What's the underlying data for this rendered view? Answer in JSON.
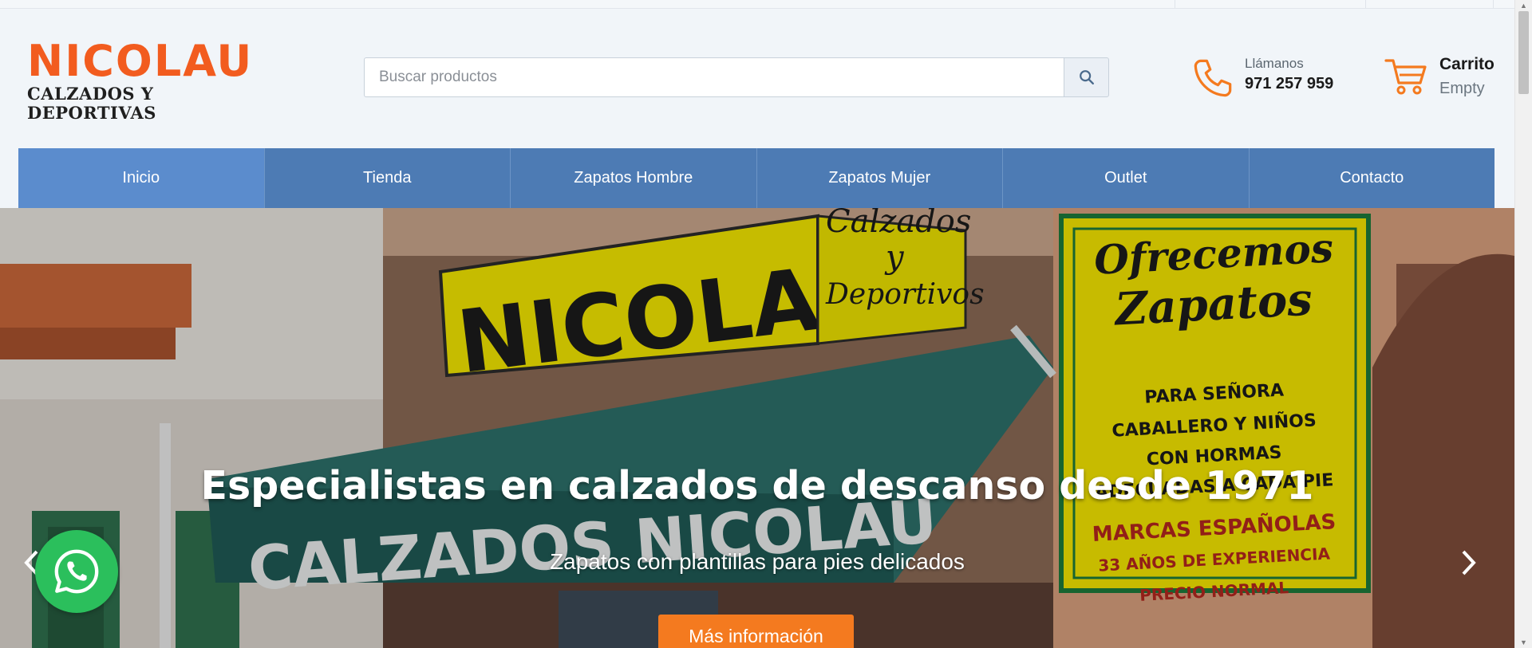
{
  "logo": {
    "name": "NICOLAU",
    "tagline": "CALZADOS Y DEPORTIVAS"
  },
  "search": {
    "placeholder": "Buscar productos",
    "value": ""
  },
  "phone": {
    "label": "Llámanos",
    "number": "971 257 959"
  },
  "cart": {
    "label": "Carrito",
    "status": "Empty"
  },
  "nav": {
    "items": [
      {
        "label": "Inicio",
        "active": true
      },
      {
        "label": "Tienda"
      },
      {
        "label": "Zapatos Hombre"
      },
      {
        "label": "Zapatos Mujer"
      },
      {
        "label": "Outlet"
      },
      {
        "label": "Contacto"
      }
    ]
  },
  "hero": {
    "title": "Especialistas en calzados de descanso desde 1971",
    "subtitle": "Zapatos con plantillas para pies delicados",
    "cta": "Más información",
    "sign_main": "NICOLAU",
    "sign_side_1": "Calzados",
    "sign_side_2": "y",
    "sign_side_3": "Deportivos",
    "poster_lines": [
      "Ofrecemos",
      "Zapatos",
      "PARA SEÑORA",
      "CABALLERO Y NIÑOS",
      "CON HORMAS",
      "ADECUADAS A CADA PIE",
      "MARCAS ESPAÑOLAS",
      "33 AÑOS DE EXPERIENCIA",
      "PRECIO NORMAL"
    ],
    "awning_text": "CALZADOS  NICOLAU"
  },
  "colors": {
    "accent": "#f47a1f",
    "nav": "#4d7bb4",
    "nav_active": "#5b8ccd",
    "whatsapp": "#2bbf5c",
    "brand": "#f25c1f"
  },
  "icons": {
    "search": "search-icon",
    "phone": "phone-icon",
    "cart": "cart-icon",
    "whatsapp": "whatsapp-icon",
    "prev": "chevron-left-icon",
    "next": "chevron-right-icon"
  }
}
